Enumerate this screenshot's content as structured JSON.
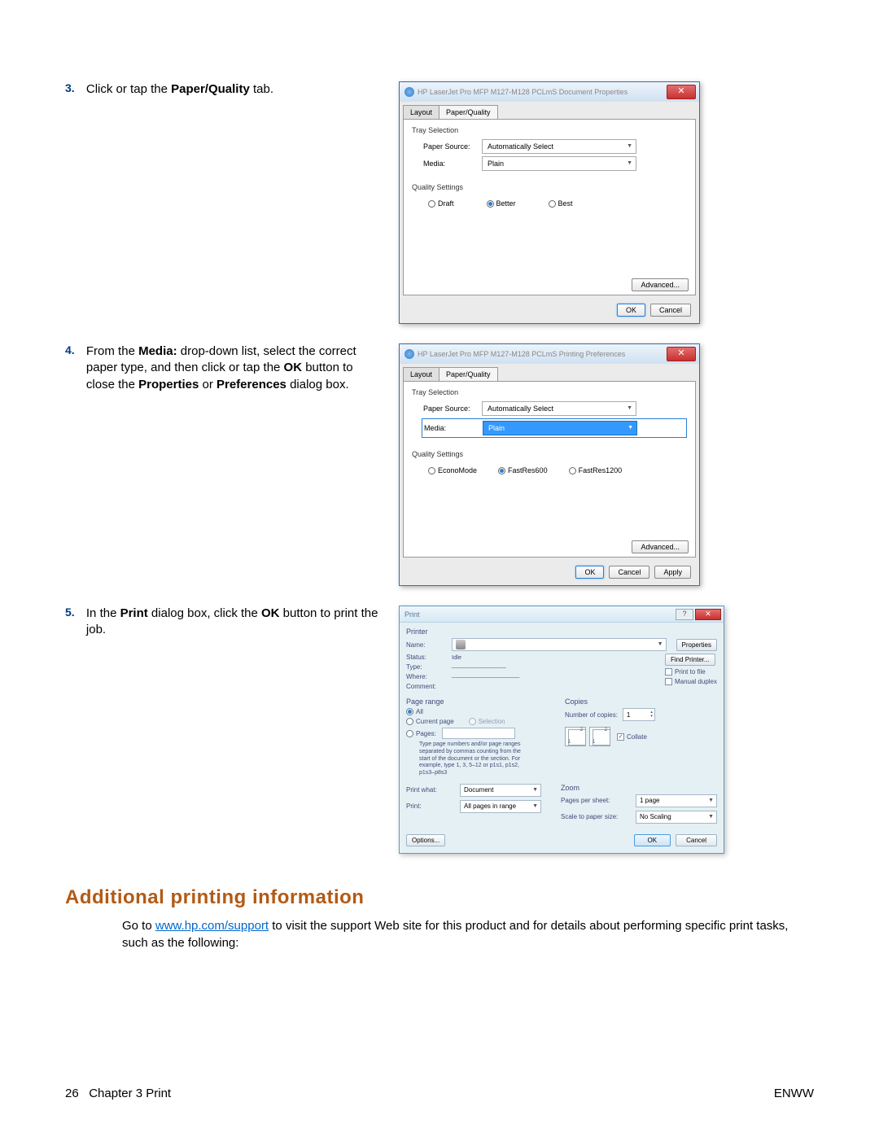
{
  "steps": {
    "s3": {
      "num": "3.",
      "pre": "Click or tap the ",
      "bold": "Paper/Quality",
      "post": " tab."
    },
    "s4": {
      "num": "4.",
      "t1": "From the ",
      "b1": "Media:",
      "t2": " drop-down list, select the correct paper type, and then click or tap the ",
      "b2": "OK",
      "t3": " button to close the ",
      "b3": "Properties",
      "t4": " or ",
      "b4": "Preferences",
      "t5": " dialog box."
    },
    "s5": {
      "num": "5.",
      "t1": "In the ",
      "b1": "Print",
      "t2": " dialog box, click the ",
      "b2": "OK",
      "t3": " button to print the job."
    }
  },
  "dlg1": {
    "title": "HP LaserJet Pro MFP M127-M128 PCLmS Document Properties",
    "tabs": {
      "layout": "Layout",
      "pq": "Paper/Quality"
    },
    "tray_section": "Tray Selection",
    "paper_source_label": "Paper Source:",
    "paper_source_value": "Automatically Select",
    "media_label": "Media:",
    "media_value": "Plain",
    "quality_section": "Quality Settings",
    "quality_opts": {
      "draft": "Draft",
      "better": "Better",
      "best": "Best"
    },
    "advanced": "Advanced...",
    "ok": "OK",
    "cancel": "Cancel"
  },
  "dlg2": {
    "title": "HP LaserJet Pro MFP M127-M128 PCLmS Printing Preferences",
    "tabs": {
      "layout": "Layout",
      "pq": "Paper/Quality"
    },
    "tray_section": "Tray Selection",
    "paper_source_label": "Paper Source:",
    "paper_source_value": "Automatically Select",
    "media_label": "Media:",
    "media_value": "Plain",
    "quality_section": "Quality Settings",
    "quality_opts": {
      "econo": "EconoMode",
      "fr600": "FastRes600",
      "fr1200": "FastRes1200"
    },
    "advanced": "Advanced...",
    "ok": "OK",
    "cancel": "Cancel",
    "apply": "Apply"
  },
  "printdlg": {
    "title": "Print",
    "printer_section": "Printer",
    "name_label": "Name:",
    "name_value": "",
    "status_label": "Status:",
    "status_value": "Idle",
    "type_label": "Type:",
    "where_label": "Where:",
    "comment_label": "Comment:",
    "properties_btn": "Properties",
    "find_printer_btn": "Find Printer...",
    "print_to_file": "Print to file",
    "manual_duplex": "Manual duplex",
    "page_range_section": "Page range",
    "all": "All",
    "current_page": "Current page",
    "selection": "Selection",
    "pages": "Pages:",
    "pages_hint": "Type page numbers and/or page ranges separated by commas counting from the start of the document or the section. For example, type 1, 3, 5–12 or p1s1, p1s2, p1s3–p8s3",
    "copies_section": "Copies",
    "num_copies_label": "Number of copies:",
    "num_copies_value": "1",
    "collate": "Collate",
    "print_what_label": "Print what:",
    "print_what_value": "Document",
    "print_label": "Print:",
    "print_value": "All pages in range",
    "zoom_section": "Zoom",
    "pps_label": "Pages per sheet:",
    "pps_value": "1 page",
    "scale_label": "Scale to paper size:",
    "scale_value": "No Scaling",
    "options_btn": "Options...",
    "ok": "OK",
    "cancel": "Cancel"
  },
  "heading": "Additional printing information",
  "support": {
    "pre": "Go to ",
    "link": "www.hp.com/support",
    "post": " to visit the support Web site for this product and for details about performing specific print tasks, such as the following:"
  },
  "footer": {
    "left_num": "26",
    "left_chap": "Chapter 3   Print",
    "right": "ENWW"
  }
}
